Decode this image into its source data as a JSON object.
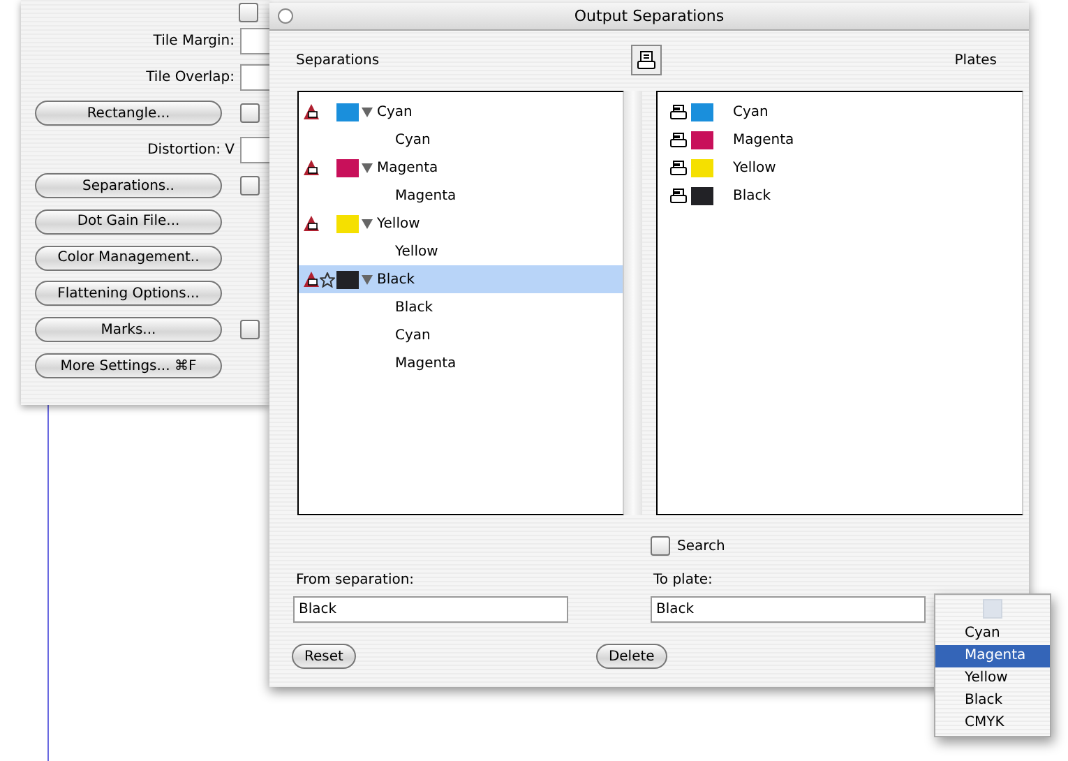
{
  "back_window": {
    "rows": [
      {
        "kind": "checkbox",
        "checked": false
      },
      {
        "kind": "field",
        "label": "Tile Margin:"
      },
      {
        "kind": "field",
        "label": "Tile Overlap:"
      },
      {
        "kind": "button",
        "label": "Rectangle...",
        "checkbox": {
          "checked": false
        }
      },
      {
        "kind": "field",
        "label": "Distortion: V"
      },
      {
        "kind": "button",
        "label": "Separations..",
        "checkbox": {
          "checked": false
        }
      },
      {
        "kind": "button",
        "label": "Dot Gain File..."
      },
      {
        "kind": "button",
        "label": "Color Management.."
      },
      {
        "kind": "button",
        "label": "Flattening Options..."
      },
      {
        "kind": "button",
        "label": "Marks...",
        "checkbox": {
          "checked": false
        }
      },
      {
        "kind": "button",
        "label": "More Settings... ⌘F"
      }
    ]
  },
  "dialog": {
    "title": "Output Separations",
    "separations": {
      "label": "Separations",
      "tree": [
        {
          "name": "Cyan",
          "color": "#1a8fdc",
          "starred": false,
          "expanded": true,
          "selected": false,
          "children": [
            {
              "name": "Cyan"
            }
          ]
        },
        {
          "name": "Magenta",
          "color": "#c8105a",
          "starred": false,
          "expanded": true,
          "selected": false,
          "children": [
            {
              "name": "Magenta"
            }
          ]
        },
        {
          "name": "Yellow",
          "color": "#f5e000",
          "starred": false,
          "expanded": true,
          "selected": false,
          "children": [
            {
              "name": "Yellow"
            }
          ]
        },
        {
          "name": "Black",
          "color": "#222226",
          "starred": true,
          "expanded": true,
          "selected": true,
          "children": [
            {
              "name": "Black"
            },
            {
              "name": "Cyan"
            },
            {
              "name": "Magenta"
            }
          ]
        }
      ]
    },
    "plates": {
      "label": "Plates",
      "items": [
        {
          "name": "Cyan",
          "color": "#1a8fdc"
        },
        {
          "name": "Magenta",
          "color": "#c8105a"
        },
        {
          "name": "Yellow",
          "color": "#f5e000"
        },
        {
          "name": "Black",
          "color": "#222226"
        }
      ]
    },
    "search": {
      "label": "Search",
      "checked": false
    },
    "from_separation": {
      "label": "From separation:",
      "value": "Black"
    },
    "to_plate": {
      "label": "To plate:",
      "value": "Black"
    },
    "buttons": [
      "Reset",
      "Delete"
    ],
    "popup_menu": {
      "items": [
        {
          "label": "Cyan",
          "selected": false
        },
        {
          "label": "Magenta",
          "selected": true
        },
        {
          "label": "Yellow",
          "selected": false
        },
        {
          "label": "Black",
          "selected": false
        },
        {
          "label": "CMYK",
          "selected": false
        }
      ]
    }
  }
}
